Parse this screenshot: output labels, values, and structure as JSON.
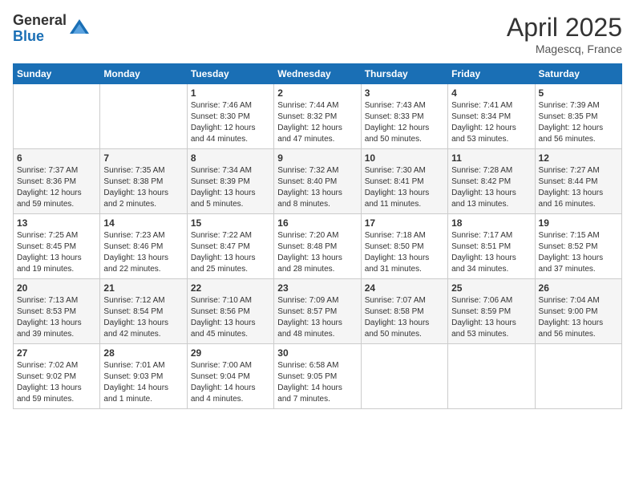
{
  "header": {
    "logo_general": "General",
    "logo_blue": "Blue",
    "month_title": "April 2025",
    "location": "Magescq, France"
  },
  "weekdays": [
    "Sunday",
    "Monday",
    "Tuesday",
    "Wednesday",
    "Thursday",
    "Friday",
    "Saturday"
  ],
  "weeks": [
    [
      {
        "day": "",
        "info": ""
      },
      {
        "day": "",
        "info": ""
      },
      {
        "day": "1",
        "info": "Sunrise: 7:46 AM\nSunset: 8:30 PM\nDaylight: 12 hours and 44 minutes."
      },
      {
        "day": "2",
        "info": "Sunrise: 7:44 AM\nSunset: 8:32 PM\nDaylight: 12 hours and 47 minutes."
      },
      {
        "day": "3",
        "info": "Sunrise: 7:43 AM\nSunset: 8:33 PM\nDaylight: 12 hours and 50 minutes."
      },
      {
        "day": "4",
        "info": "Sunrise: 7:41 AM\nSunset: 8:34 PM\nDaylight: 12 hours and 53 minutes."
      },
      {
        "day": "5",
        "info": "Sunrise: 7:39 AM\nSunset: 8:35 PM\nDaylight: 12 hours and 56 minutes."
      }
    ],
    [
      {
        "day": "6",
        "info": "Sunrise: 7:37 AM\nSunset: 8:36 PM\nDaylight: 12 hours and 59 minutes."
      },
      {
        "day": "7",
        "info": "Sunrise: 7:35 AM\nSunset: 8:38 PM\nDaylight: 13 hours and 2 minutes."
      },
      {
        "day": "8",
        "info": "Sunrise: 7:34 AM\nSunset: 8:39 PM\nDaylight: 13 hours and 5 minutes."
      },
      {
        "day": "9",
        "info": "Sunrise: 7:32 AM\nSunset: 8:40 PM\nDaylight: 13 hours and 8 minutes."
      },
      {
        "day": "10",
        "info": "Sunrise: 7:30 AM\nSunset: 8:41 PM\nDaylight: 13 hours and 11 minutes."
      },
      {
        "day": "11",
        "info": "Sunrise: 7:28 AM\nSunset: 8:42 PM\nDaylight: 13 hours and 13 minutes."
      },
      {
        "day": "12",
        "info": "Sunrise: 7:27 AM\nSunset: 8:44 PM\nDaylight: 13 hours and 16 minutes."
      }
    ],
    [
      {
        "day": "13",
        "info": "Sunrise: 7:25 AM\nSunset: 8:45 PM\nDaylight: 13 hours and 19 minutes."
      },
      {
        "day": "14",
        "info": "Sunrise: 7:23 AM\nSunset: 8:46 PM\nDaylight: 13 hours and 22 minutes."
      },
      {
        "day": "15",
        "info": "Sunrise: 7:22 AM\nSunset: 8:47 PM\nDaylight: 13 hours and 25 minutes."
      },
      {
        "day": "16",
        "info": "Sunrise: 7:20 AM\nSunset: 8:48 PM\nDaylight: 13 hours and 28 minutes."
      },
      {
        "day": "17",
        "info": "Sunrise: 7:18 AM\nSunset: 8:50 PM\nDaylight: 13 hours and 31 minutes."
      },
      {
        "day": "18",
        "info": "Sunrise: 7:17 AM\nSunset: 8:51 PM\nDaylight: 13 hours and 34 minutes."
      },
      {
        "day": "19",
        "info": "Sunrise: 7:15 AM\nSunset: 8:52 PM\nDaylight: 13 hours and 37 minutes."
      }
    ],
    [
      {
        "day": "20",
        "info": "Sunrise: 7:13 AM\nSunset: 8:53 PM\nDaylight: 13 hours and 39 minutes."
      },
      {
        "day": "21",
        "info": "Sunrise: 7:12 AM\nSunset: 8:54 PM\nDaylight: 13 hours and 42 minutes."
      },
      {
        "day": "22",
        "info": "Sunrise: 7:10 AM\nSunset: 8:56 PM\nDaylight: 13 hours and 45 minutes."
      },
      {
        "day": "23",
        "info": "Sunrise: 7:09 AM\nSunset: 8:57 PM\nDaylight: 13 hours and 48 minutes."
      },
      {
        "day": "24",
        "info": "Sunrise: 7:07 AM\nSunset: 8:58 PM\nDaylight: 13 hours and 50 minutes."
      },
      {
        "day": "25",
        "info": "Sunrise: 7:06 AM\nSunset: 8:59 PM\nDaylight: 13 hours and 53 minutes."
      },
      {
        "day": "26",
        "info": "Sunrise: 7:04 AM\nSunset: 9:00 PM\nDaylight: 13 hours and 56 minutes."
      }
    ],
    [
      {
        "day": "27",
        "info": "Sunrise: 7:02 AM\nSunset: 9:02 PM\nDaylight: 13 hours and 59 minutes."
      },
      {
        "day": "28",
        "info": "Sunrise: 7:01 AM\nSunset: 9:03 PM\nDaylight: 14 hours and 1 minute."
      },
      {
        "day": "29",
        "info": "Sunrise: 7:00 AM\nSunset: 9:04 PM\nDaylight: 14 hours and 4 minutes."
      },
      {
        "day": "30",
        "info": "Sunrise: 6:58 AM\nSunset: 9:05 PM\nDaylight: 14 hours and 7 minutes."
      },
      {
        "day": "",
        "info": ""
      },
      {
        "day": "",
        "info": ""
      },
      {
        "day": "",
        "info": ""
      }
    ]
  ]
}
